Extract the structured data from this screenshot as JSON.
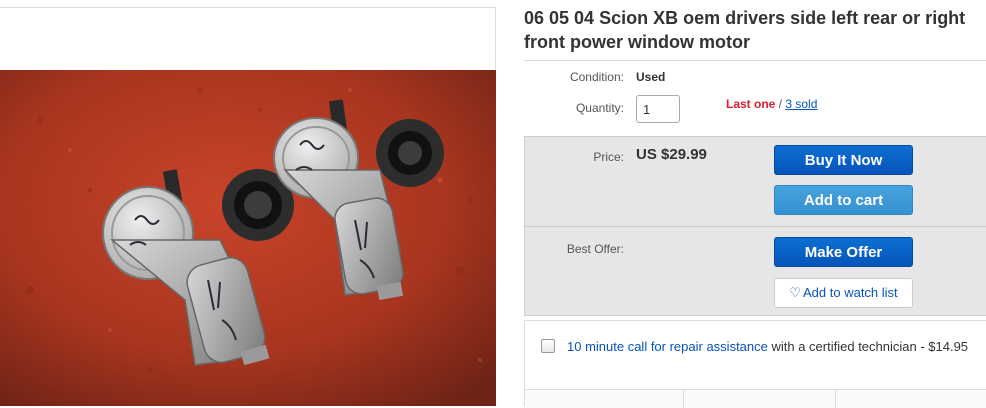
{
  "listing": {
    "title": "06 05 04 Scion XB oem drivers side left rear or right front power window motor"
  },
  "condition": {
    "label": "Condition:",
    "value": "Used"
  },
  "quantity": {
    "label": "Quantity:",
    "value": "1",
    "last_one": "Last one",
    "separator": " / ",
    "sold": "3 sold"
  },
  "price": {
    "label": "Price:",
    "value": "US $29.99"
  },
  "buttons": {
    "buy_now": "Buy It Now",
    "add_to_cart": "Add to cart",
    "make_offer": "Make Offer",
    "watch": "Add to watch list"
  },
  "best_offer": {
    "label": "Best Offer:"
  },
  "addon": {
    "link": "10 minute call for repair assistance",
    "text": " with a certified technician - $14.95"
  },
  "colors": {
    "primary_blue": "#0654ba",
    "secondary_blue": "#3591d0",
    "alert_red": "#dd1e31"
  },
  "icons": {
    "watch": "heart-icon",
    "checkbox": "checkbox-icon"
  }
}
